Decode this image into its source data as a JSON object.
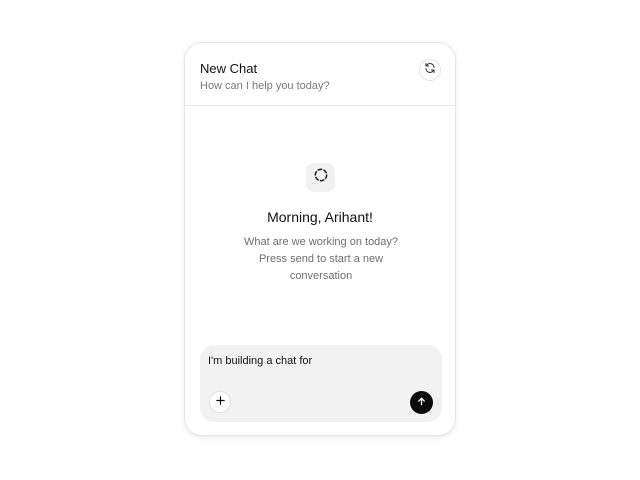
{
  "header": {
    "title": "New Chat",
    "subtitle": "How can I help you today?",
    "refresh_icon": "refresh-icon"
  },
  "empty_state": {
    "icon": "dashed-circle-icon",
    "greeting": "Morning, Arihant!",
    "description": "What are we working on today? Press send to start a new conversation"
  },
  "composer": {
    "value": "I'm building a chat for",
    "add_icon": "plus-icon",
    "send_icon": "arrow-up-icon"
  },
  "colors": {
    "send_button": "#0b0b0b",
    "composer_background": "#f2f2f2"
  }
}
